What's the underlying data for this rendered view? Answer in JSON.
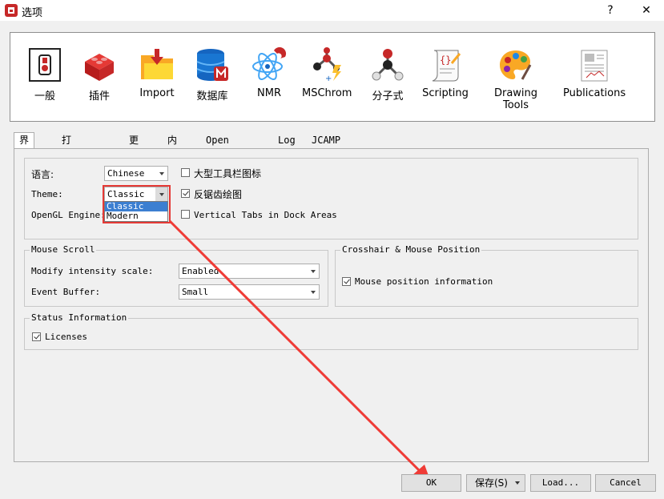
{
  "window": {
    "title": "选项",
    "help": "?",
    "close": "✕"
  },
  "toolbar": [
    {
      "label": "一般",
      "icon": "switch-icon"
    },
    {
      "label": "插件",
      "icon": "plugin-brick-icon"
    },
    {
      "label": "Import",
      "icon": "import-folder-icon"
    },
    {
      "label": "数据库",
      "icon": "database-icon"
    },
    {
      "label": "NMR",
      "icon": "atom-magnet-icon"
    },
    {
      "label": "MSChrom",
      "icon": "molecule-lightning-icon"
    },
    {
      "label": "分子式",
      "icon": "molecule-icon"
    },
    {
      "label": "Scripting",
      "icon": "script-scroll-icon"
    },
    {
      "label": "Drawing Tools",
      "icon": "palette-icon"
    },
    {
      "label": "Publications",
      "icon": "newspaper-icon"
    }
  ],
  "tabs": [
    "界面",
    "打印 & PDF",
    "更新",
    "内存",
    "Open & Save",
    "Log",
    "JCAMP"
  ],
  "interface": {
    "language_label": "语言:",
    "language_value": "Chinese",
    "theme_label": "Theme:",
    "theme_value": "Classic",
    "theme_options": [
      "Classic",
      "Modern"
    ],
    "opengl_label": "OpenGL Engine:",
    "large_toolbar_label": "大型工具栏图标",
    "antialias_label": "反锯齿绘图",
    "vertical_tabs_label": "Vertical Tabs in Dock Areas"
  },
  "mouse_scroll": {
    "title": "Mouse Scroll",
    "modify_label": "Modify intensity scale:",
    "modify_value": "Enabled",
    "buffer_label": "Event Buffer:",
    "buffer_value": "Small"
  },
  "crosshair": {
    "title": "Crosshair & Mouse Position",
    "mouse_pos_label": "Mouse position information"
  },
  "status": {
    "title": "Status Information",
    "licenses_label": "Licenses"
  },
  "buttons": {
    "ok": "OK",
    "save": "保存(S)",
    "load": "Load...",
    "cancel": "Cancel"
  }
}
